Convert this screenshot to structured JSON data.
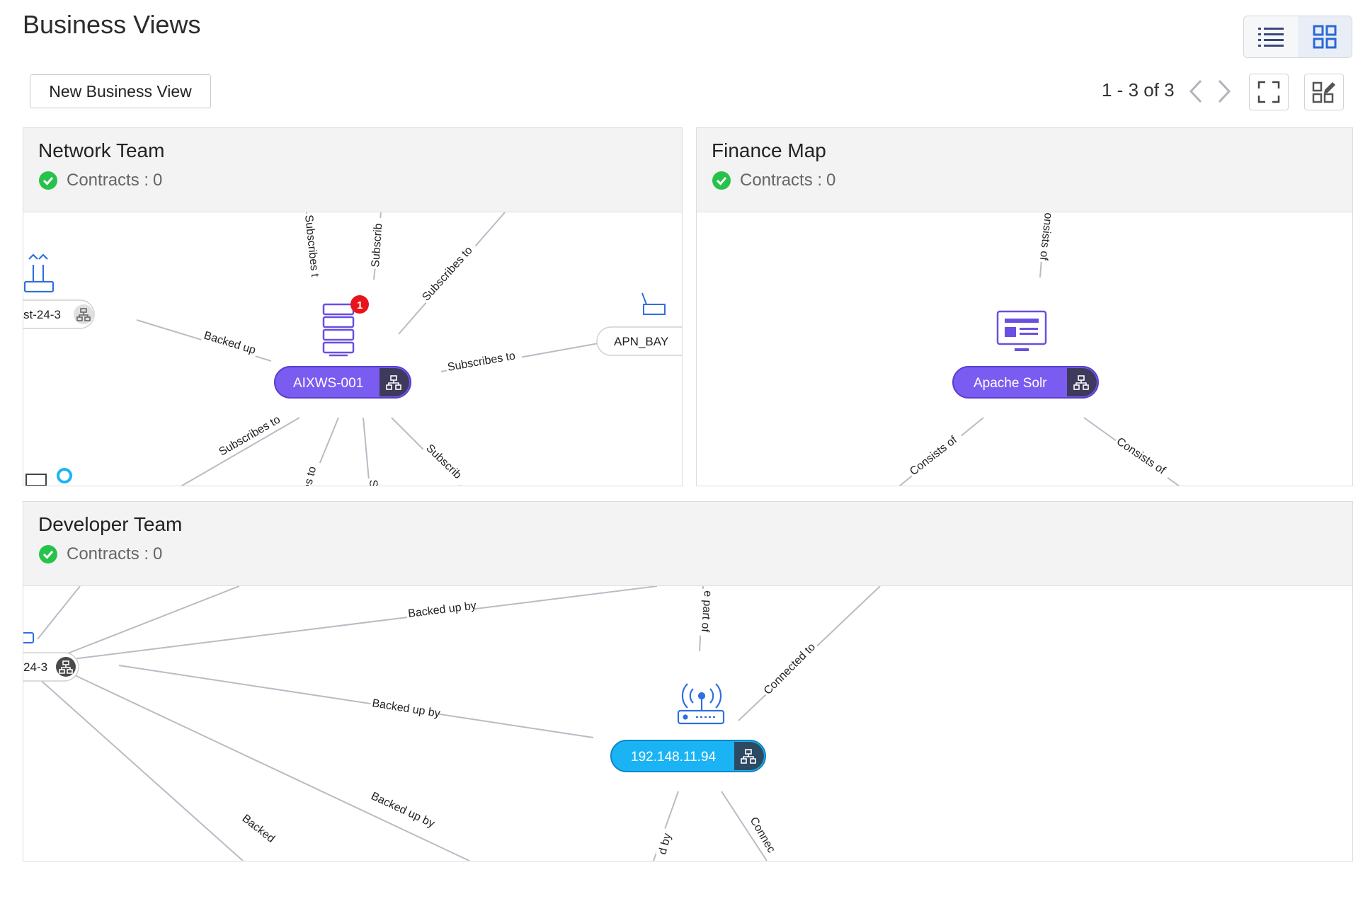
{
  "page": {
    "title": "Business Views"
  },
  "toolbar": {
    "new_button": "New Business View",
    "pagination": "1 - 3 of 3",
    "icons": {
      "list": "list-view-icon",
      "grid": "grid-view-icon",
      "prev": "chevron-left-icon",
      "next": "chevron-right-icon",
      "fullscreen": "fullscreen-icon",
      "edit_layout": "edit-layout-icon"
    }
  },
  "cards": [
    {
      "title": "Network Team",
      "contracts_label": "Contracts :",
      "contracts_value": "0",
      "main_node": "AIXWS-001",
      "alarm_count": "1",
      "left_node": "st-24-3",
      "right_node": "APN_BAY",
      "edges": {
        "subscribes_t": "Subscribes t",
        "subscrib": "Subscrib",
        "subscribes_to_ne": "Subscribes to",
        "backed_up": "Backed up",
        "subscribes_to_e": "Subscribes to",
        "subscribes_to_sw": "Subscribes to",
        "es_to": "es to",
        "s": "S",
        "subscrib_se": "Subscrib"
      }
    },
    {
      "title": "Finance Map",
      "contracts_label": "Contracts :",
      "contracts_value": "0",
      "main_node": "Apache Solr",
      "edges": {
        "onsists_of": "onsists of",
        "consists_of_sw": "Consists of",
        "consists_of_se": "Consists of"
      }
    },
    {
      "title": "Developer Team",
      "contracts_label": "Contracts :",
      "contracts_value": "0",
      "main_node": "192.148.11.94",
      "left_node": "24-3",
      "edges": {
        "backed_up_by_top": "Backed up by",
        "e_part_of": "e part of",
        "connected_to": "Connected to",
        "backed_up_by_mid": "Backed up by",
        "backed_up_by_low": "Backed up by",
        "backed": "Backed",
        "d_by": "d by",
        "connec": "Connec"
      }
    }
  ],
  "colors": {
    "purple_node": "#7a5cf0",
    "blue_node": "#1ab4f5",
    "ok_green": "#27c24c",
    "alarm_red": "#e8141b",
    "edge": "#b8bcc4"
  }
}
